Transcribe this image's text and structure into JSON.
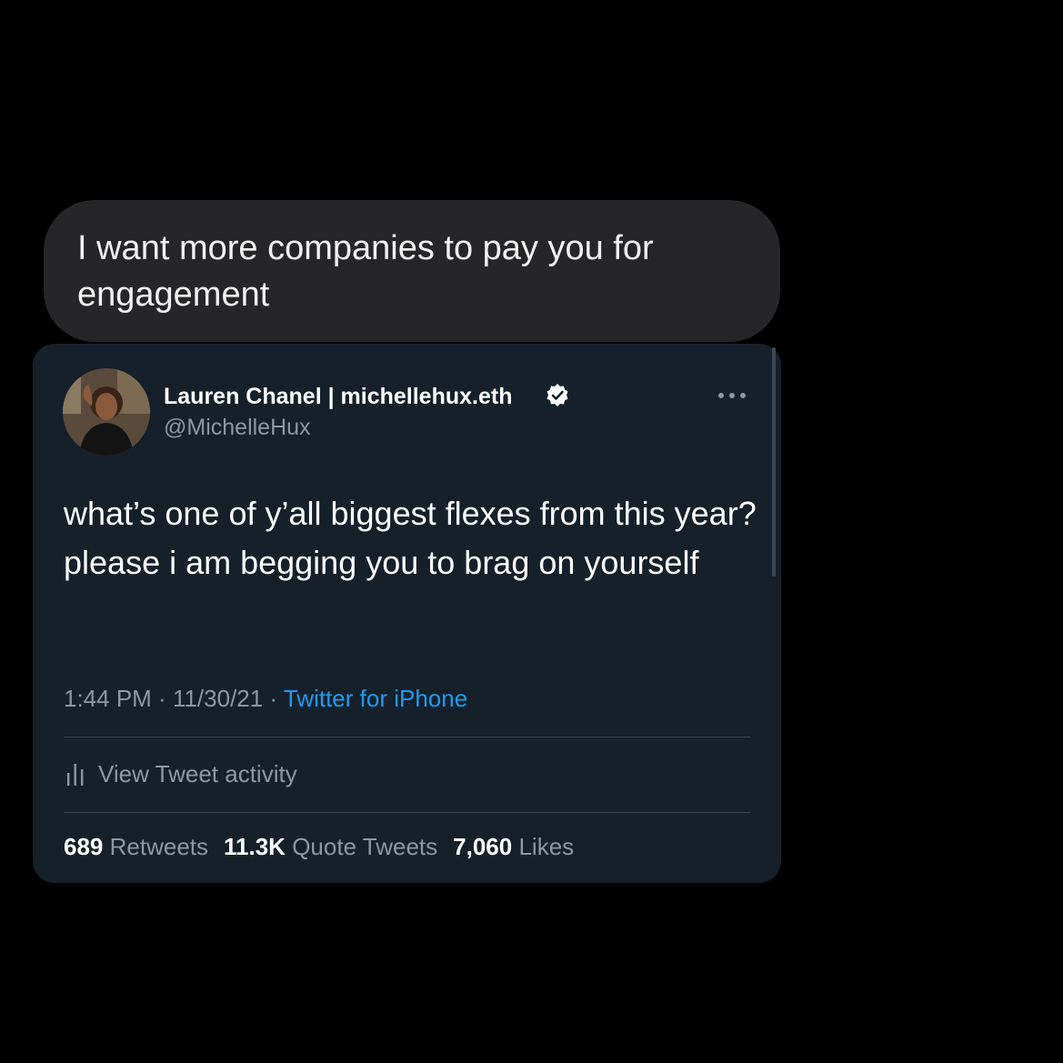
{
  "message": {
    "text": "I want more companies to pay you for\nengagement"
  },
  "tweet": {
    "author_name": "Lauren Chanel | michellehux.eth",
    "author_handle": "@MichelleHux",
    "verified": true,
    "text": "what’s one of y’all biggest flexes from this year? please i am begging you to brag on yourself",
    "time": "1:44 PM",
    "date": "11/30/21",
    "source": "Twitter for iPhone",
    "separator": " · ",
    "activity_label": "View Tweet activity",
    "stats": [
      {
        "count": "689",
        "label": "Retweets"
      },
      {
        "count": "11.3K",
        "label": "Quote Tweets"
      },
      {
        "count": "7,060",
        "label": "Likes"
      }
    ]
  },
  "colors": {
    "background": "#000000",
    "bubble": "#262628",
    "card": "#15202b",
    "accent": "#1d9bf0",
    "muted_text": "#8b98a5"
  },
  "icons": {
    "verified": "verified-badge-icon",
    "more": "more-options-icon",
    "activity": "bar-chart-icon"
  }
}
